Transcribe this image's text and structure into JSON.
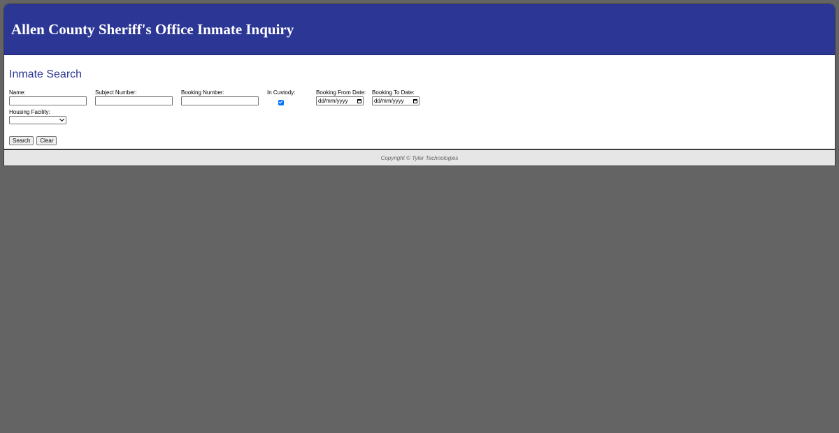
{
  "header": {
    "title": "Allen County Sheriff's Office Inmate Inquiry"
  },
  "search": {
    "title": "Inmate Search",
    "name_label": "Name:",
    "name_value": "",
    "subject_label": "Subject Number:",
    "subject_value": "",
    "booking_label": "Booking Number:",
    "booking_value": "",
    "custody_label": "In Custody:",
    "custody_checked": true,
    "from_date_label": "Booking From Date:",
    "from_date_placeholder": "dd/mm/yyyy",
    "to_date_label": "Booking To Date:",
    "to_date_placeholder": "dd/mm/yyyy",
    "housing_label": "Housing Facility:",
    "housing_value": "",
    "search_button": "Search",
    "clear_button": "Clear"
  },
  "footer": {
    "copyright": "Copyright © Tyler Technologies"
  },
  "colors": {
    "header_bg": "#2b3695",
    "page_bg": "#646464",
    "accent": "#0075ff"
  },
  "icons": {
    "calendar": "calendar-icon",
    "dropdown": "chevron-down-icon",
    "checkbox": "checkmark-icon"
  }
}
